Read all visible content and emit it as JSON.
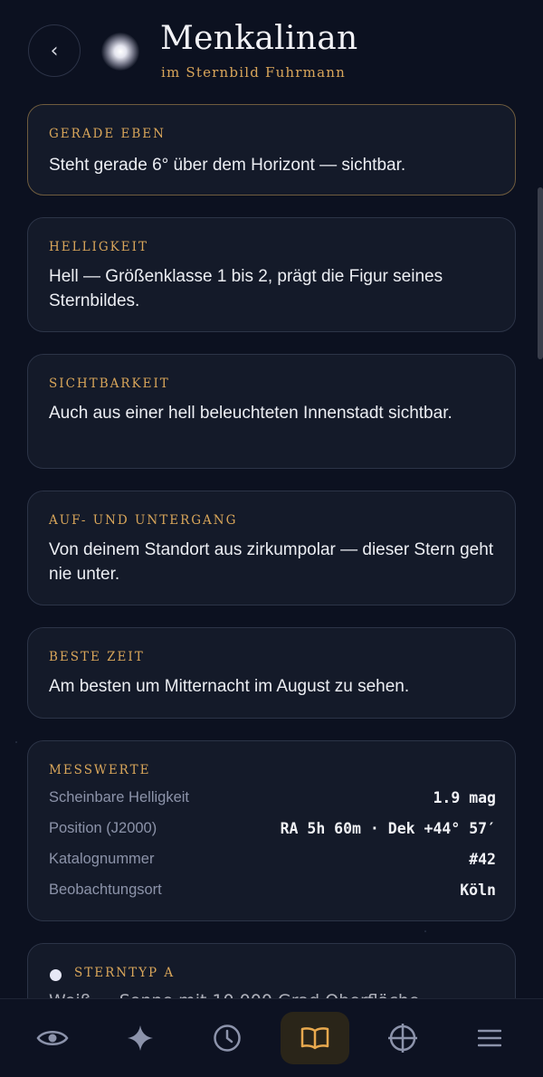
{
  "header": {
    "back_label": "‹",
    "title": "Menkalinan",
    "subtitle": "im Sternbild Fuhrmann"
  },
  "cards": [
    {
      "label": "GERADE EBEN",
      "text": "Steht gerade 6° über dem Horizont — sichtbar."
    },
    {
      "label": "HELLIGKEIT",
      "text": "Hell — Größenklasse 1 bis 2, prägt die Figur seines Sternbildes."
    },
    {
      "label": "SICHTBARKEIT",
      "text": "Auch aus einer hell beleuchteten Innenstadt sichtbar."
    },
    {
      "label": "AUF- UND UNTERGANG",
      "text": "Von deinem Standort aus zirkumpolar — dieser Stern geht nie unter."
    },
    {
      "label": "BESTE ZEIT",
      "text": "Am besten um Mitternacht im August zu sehen."
    }
  ],
  "measurements": {
    "label": "MESSWERTE",
    "rows": [
      {
        "label": "Scheinbare Helligkeit",
        "value": "1.9 mag"
      },
      {
        "label": "Position (J2000)",
        "value": "RA 5h 60m · Dek +44° 57′"
      },
      {
        "label": "Katalognummer",
        "value": "#42"
      },
      {
        "label": "Beobachtungsort",
        "value": "Köln"
      }
    ]
  },
  "star_type": {
    "label": "STERNTYP A",
    "partial_text": "Weiß — Sonne mit 10.000 Grad Oberfläche …"
  },
  "nav": {
    "items": [
      "eye-icon",
      "sparkle-icon",
      "clock-icon",
      "book-icon",
      "crosshair-icon",
      "menu-icon"
    ],
    "active_index": 3
  },
  "colors": {
    "background": "#0c1120",
    "card": "#141a29",
    "accent_gold": "#d9a65a",
    "active_nav_bg": "#2a2519"
  }
}
